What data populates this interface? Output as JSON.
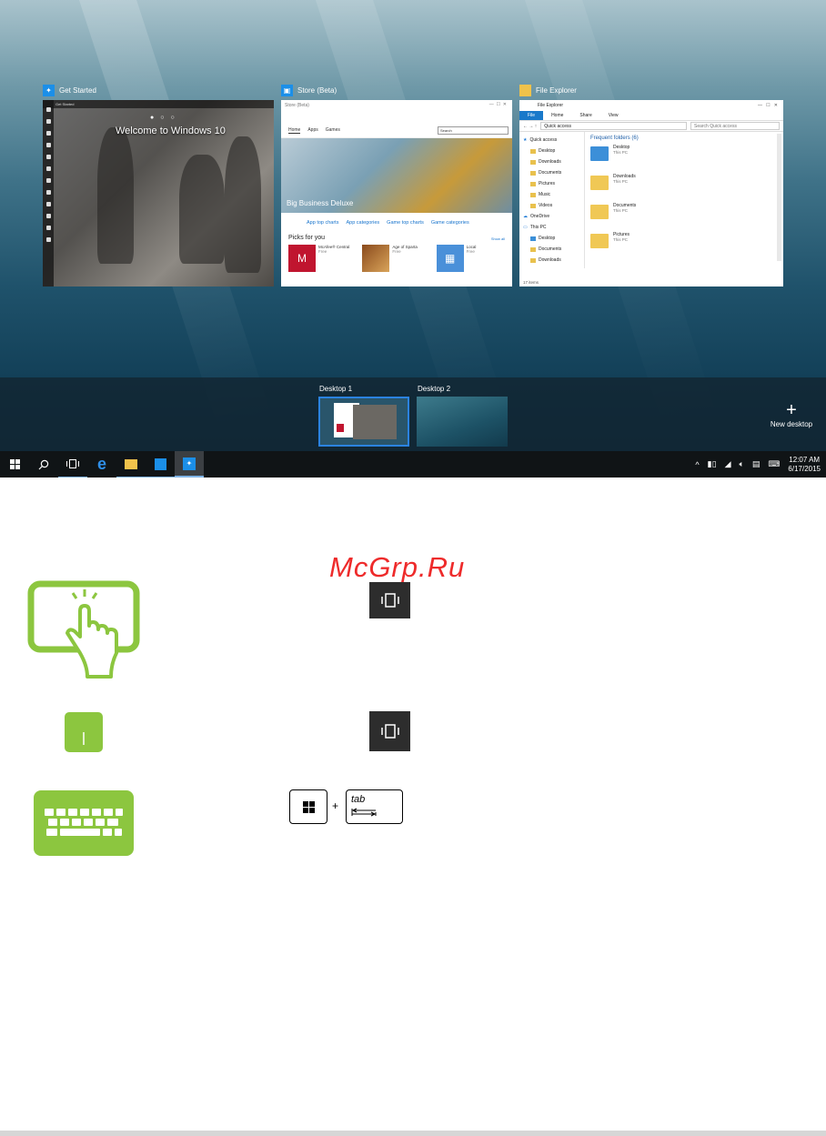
{
  "windows": {
    "get_started": {
      "title": "Get Started",
      "topbar": "Get Started",
      "headline": "Welcome to Windows 10"
    },
    "store": {
      "title": "Store (Beta)",
      "topbar": "Store (Beta)",
      "tabs": [
        "Home",
        "Apps",
        "Games"
      ],
      "search_placeholder": "Search",
      "hero_caption": "Big Business Deluxe",
      "categories": [
        "App top charts",
        "App categories",
        "Game top charts",
        "Game categories"
      ],
      "picks_title": "Picks for you",
      "show_all": "Show all",
      "picks": [
        {
          "name": "McAfee® Central",
          "meta": "Free"
        },
        {
          "name": "Age of Sparta",
          "meta": "Free"
        },
        {
          "name": "Local",
          "meta": "Free"
        }
      ]
    },
    "file_explorer": {
      "title": "File Explorer",
      "window_title": "File Explorer",
      "ribbon_tabs": [
        "File",
        "Home",
        "Share",
        "View"
      ],
      "address": "Quick access",
      "search_placeholder": "Search Quick access",
      "nav": [
        "Quick access",
        "Desktop",
        "Downloads",
        "Documents",
        "Pictures",
        "Music",
        "Videos",
        "OneDrive",
        "This PC",
        "Desktop",
        "Documents",
        "Downloads"
      ],
      "group_title": "Frequent folders (6)",
      "folders": [
        {
          "name": "Desktop",
          "location": "This PC"
        },
        {
          "name": "Downloads",
          "location": "This PC"
        },
        {
          "name": "Documents",
          "location": "This PC"
        },
        {
          "name": "Pictures",
          "location": "This PC"
        }
      ],
      "status": "17 items"
    }
  },
  "desktops": {
    "desktop1_label": "Desktop 1",
    "desktop2_label": "Desktop 2",
    "new_desktop_label": "New desktop"
  },
  "taskbar": {
    "time": "12:07 AM",
    "date": "6/17/2015"
  },
  "watermark": "McGrp.Ru",
  "keyboard": {
    "tab_key_label": "tab",
    "plus": "+"
  },
  "colors": {
    "accent_blue": "#2b83e0",
    "gesture_green": "#8cc63f",
    "watermark_red": "#ee2b2b"
  }
}
